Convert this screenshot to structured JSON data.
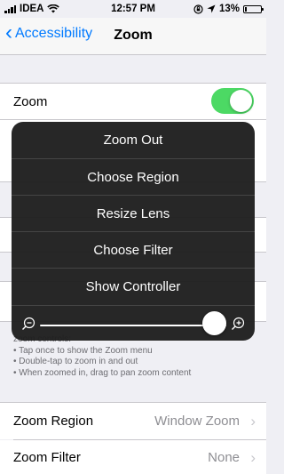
{
  "status_bar": {
    "carrier": "IDEA",
    "time": "12:57 PM",
    "battery": "13%",
    "battery_level": 0.13
  },
  "nav": {
    "back_label": "Accessibility",
    "title": "Zoom"
  },
  "zoom_cell": {
    "label": "Zoom",
    "toggle_on": true
  },
  "menu": {
    "items": [
      "Zoom Out",
      "Choose Region",
      "Resize Lens",
      "Choose Filter",
      "Show Controller"
    ],
    "zoom_level": 0.98
  },
  "footnote": {
    "lines": [
      "zoom controls:",
      "• Tap once to show the Zoom menu",
      "• Double-tap to zoom in and out",
      "• When zoomed in, drag to pan zoom content"
    ]
  },
  "settings": [
    {
      "label": "Zoom Region",
      "value": "Window Zoom"
    },
    {
      "label": "Zoom Filter",
      "value": "None"
    }
  ],
  "colors": {
    "accent": "#007aff",
    "toggle_on": "#4cd964",
    "menu_bg": "#1e1e1e"
  }
}
